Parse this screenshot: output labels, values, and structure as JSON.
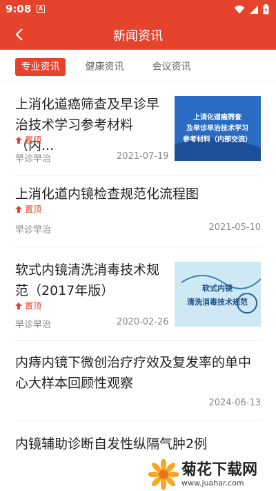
{
  "status_bar": {
    "time": "9:08",
    "app_icon_letter": "A"
  },
  "header": {
    "title": "新闻资讯",
    "back_icon": "chevron-left-icon"
  },
  "tabs": [
    {
      "label": "专业资讯",
      "active": true
    },
    {
      "label": "健康资讯",
      "active": false
    },
    {
      "label": "会议资讯",
      "active": false
    }
  ],
  "articles": [
    {
      "title_line1": "上消化道癌筛查及早诊早",
      "title_line2": "治技术学习参考材料（内...",
      "pinned_label": "置顶",
      "source": "早诊早治",
      "date": "2021-07-19",
      "thumb_lines": [
        "上消化道癌筛查",
        "及早诊早治技术学习",
        "参考材料（内部交流）"
      ]
    },
    {
      "title_line1": "上消化道内镜检查规范化流程图",
      "pinned_label": "置顶",
      "source": "早诊早治",
      "date": "2021-05-10"
    },
    {
      "title_line1": "软式内镜清洗消毒技术规",
      "title_line2": "范（2017年版）",
      "pinned_label": "置顶",
      "source": "早诊早治",
      "date": "2020-02-26",
      "thumb_lines": [
        "软式内镜",
        "清洗消毒技术规范"
      ]
    },
    {
      "title_line1": "内痔内镜下微创治疗疗效及复发率的单中",
      "title_line2": "心大样本回顾性观察",
      "date": "2024-06-13"
    },
    {
      "title_line1": "内镜辅助诊断自发性纵隔气肿2例"
    }
  ],
  "watermark": {
    "text": "菊花下载网",
    "url": "www.juahar.com"
  },
  "colors": {
    "brand": "#e5432c",
    "text": "#222222",
    "muted": "#888888"
  }
}
